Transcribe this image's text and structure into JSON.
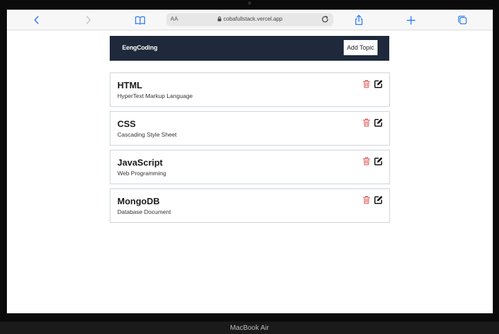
{
  "browser": {
    "address_aa": "AA",
    "url": "cobafullstack.vercel.app"
  },
  "navbar": {
    "brand": "EengCoding",
    "add_button_label": "Add Topic"
  },
  "topics": [
    {
      "title": "HTML",
      "description": "HyperText Markup Language"
    },
    {
      "title": "CSS",
      "description": "Cascading Style Sheet"
    },
    {
      "title": "JavaScript",
      "description": "Web Programming"
    },
    {
      "title": "MongoDB",
      "description": "Database Document"
    }
  ],
  "icons": {
    "delete": "trash-icon",
    "edit": "edit-icon"
  },
  "colors": {
    "navbar_bg": "#1e293b",
    "delete_icon": "#e05a5a",
    "safari_accent": "#2f7cf6"
  },
  "device": {
    "label": "MacBook Air"
  }
}
